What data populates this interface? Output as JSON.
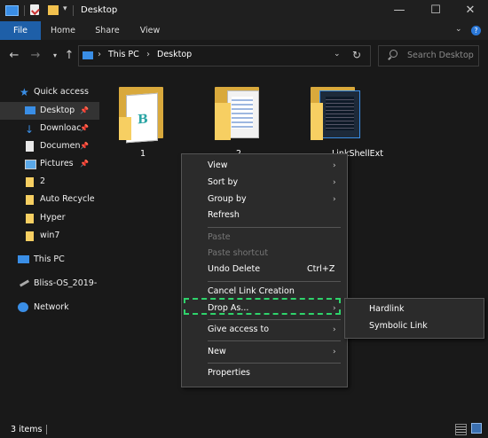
{
  "window": {
    "title": "Desktop",
    "minimize": "—",
    "maximize": "☐",
    "close": "✕"
  },
  "ribbon": {
    "tabs": [
      "File",
      "Home",
      "Share",
      "View"
    ]
  },
  "address": {
    "segments": [
      "This PC",
      "Desktop"
    ],
    "separator": "›"
  },
  "search": {
    "placeholder": "Search Desktop"
  },
  "sidebar": {
    "items": [
      {
        "label": "Quick access",
        "icon": "star-icon"
      },
      {
        "label": "Desktop",
        "icon": "desktop-icon",
        "pinned": true
      },
      {
        "label": "Downloac",
        "icon": "download-icon",
        "pinned": true
      },
      {
        "label": "Documen",
        "icon": "documents-icon",
        "pinned": true
      },
      {
        "label": "Pictures",
        "icon": "pictures-icon",
        "pinned": true
      },
      {
        "label": "2",
        "icon": "folder-icon"
      },
      {
        "label": "Auto Recycle",
        "icon": "folder-icon"
      },
      {
        "label": "Hyper",
        "icon": "folder-icon"
      },
      {
        "label": "win7",
        "icon": "folder-icon"
      },
      {
        "label": "This PC",
        "icon": "pc-icon"
      },
      {
        "label": "Bliss-OS_2019-",
        "icon": "drive-icon"
      },
      {
        "label": "Network",
        "icon": "network-icon"
      }
    ]
  },
  "files": [
    {
      "name": "1"
    },
    {
      "name": "2"
    },
    {
      "name": "LinkShellExt"
    }
  ],
  "context_menu": {
    "items": [
      {
        "label": "View",
        "submenu": true
      },
      {
        "label": "Sort by",
        "submenu": true
      },
      {
        "label": "Group by",
        "submenu": true
      },
      {
        "label": "Refresh"
      },
      {
        "label": "Paste",
        "disabled": true
      },
      {
        "label": "Paste shortcut",
        "disabled": true
      },
      {
        "label": "Undo Delete",
        "shortcut": "Ctrl+Z"
      },
      {
        "label": "Cancel Link Creation"
      },
      {
        "label": "Drop As...",
        "submenu": true
      },
      {
        "label": "Give access to",
        "submenu": true
      },
      {
        "label": "New",
        "submenu": true
      },
      {
        "label": "Properties"
      }
    ],
    "arrow": "›"
  },
  "submenu": {
    "items": [
      "Hardlink",
      "Symbolic Link"
    ]
  },
  "status": {
    "text": "3 items"
  },
  "colors": {
    "accent": "#1e5fa8",
    "highlight": "#2fd36b",
    "folder": "#f7cf62"
  }
}
